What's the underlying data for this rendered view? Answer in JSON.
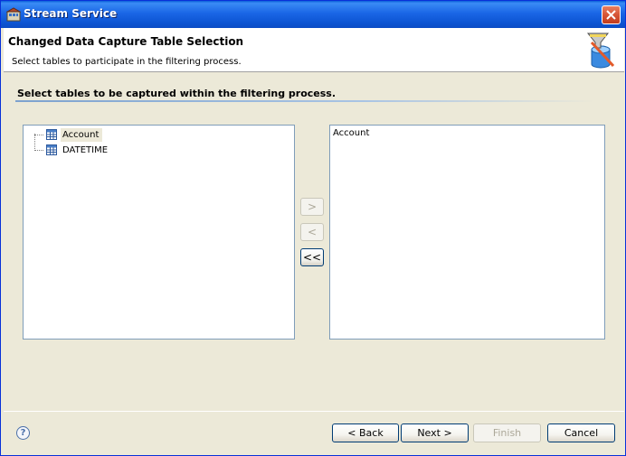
{
  "window": {
    "title": "Stream Service",
    "icons": {
      "app": "stream-service-app-icon",
      "close": "close-x-icon"
    }
  },
  "header": {
    "title": "Changed Data Capture Table Selection",
    "description": "Select tables to participate in the filtering process.",
    "icon": "filter-database-icon"
  },
  "section": {
    "title": "Select tables to be captured within the filtering process."
  },
  "available_tables": {
    "items": [
      {
        "label": "Account",
        "icon": "table-icon",
        "selected": true
      },
      {
        "label": "DATETIME",
        "icon": "table-icon",
        "selected": false
      }
    ]
  },
  "transfer_buttons": {
    "add_label": ">",
    "remove_label": "<",
    "remove_all_label": "<<",
    "add_enabled": false,
    "remove_enabled": false,
    "remove_all_enabled": true
  },
  "captured_tables": {
    "items": [
      "Account"
    ]
  },
  "footer": {
    "help_icon": "help-question-icon",
    "back_label": "< Back",
    "next_label": "Next >",
    "finish_label": "Finish",
    "cancel_label": "Cancel",
    "finish_enabled": false
  },
  "colors": {
    "titlebar": "#0a5fd8",
    "dialog_bg": "#ece9d8",
    "list_border": "#7f9db9",
    "button_border": "#003c74"
  }
}
